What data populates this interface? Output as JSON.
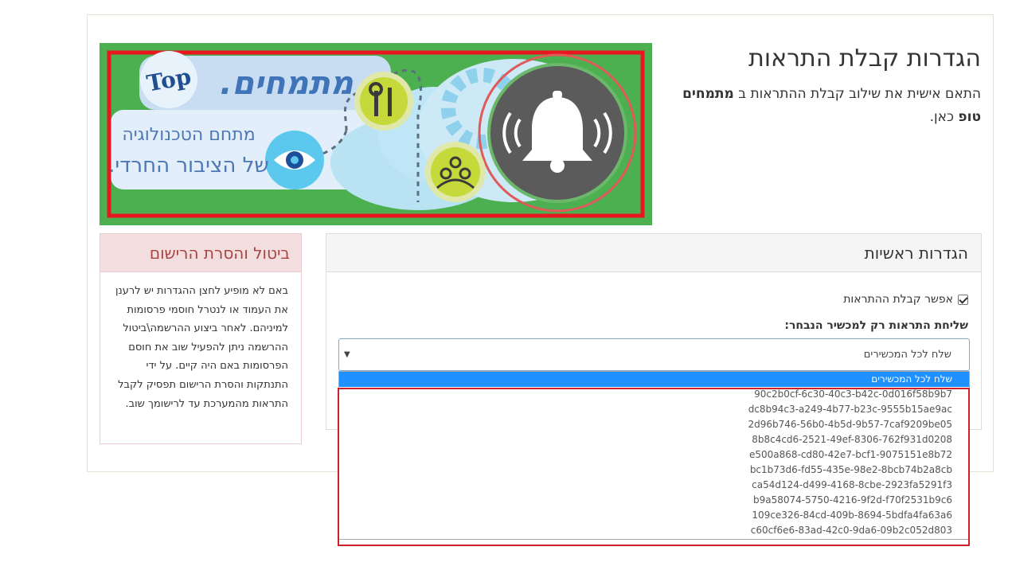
{
  "header": {
    "title": "הגדרות קבלת התראות",
    "intro_before": "התאם אישית את שילוב קבלת ההתראות ב ",
    "intro_brand": "מתמחים טופ",
    "intro_after": " כאן."
  },
  "banner": {
    "brand_text": "מתמחים.",
    "badge_text": "Top",
    "tagline_line1": "מתחם הטכנולוגיה",
    "tagline_line2": "של הציבור החרדי."
  },
  "main_panel": {
    "title": "הגדרות ראשיות",
    "enable_label": "אפשר קבלת ההתראות",
    "enable_checked": true,
    "device_field_label": "שליחת התראות רק למכשיר הנבחר:",
    "select_value": "שלח לכל המכשירים",
    "dropdown_options": [
      "שלח לכל המכשירים",
      "90c2b0cf-6c30-40c3-b42c-0d016f58b9b7",
      "dc8b94c3-a249-4b77-b23c-9555b15ae9ac",
      "2d96b746-56b0-4b5d-9b57-7caf9209be05",
      "8b8c4cd6-2521-49ef-8306-762f931d0208",
      "e500a868-cd80-42e7-bcf1-9075151e8b72",
      "bc1b73d6-fd55-435e-98e2-8bcb74b2a8cb",
      "ca54d124-d499-4168-8cbe-2923fa5291f3",
      "b9a58074-5750-4216-9f2d-f70f2531b9c6",
      "109ce326-84cd-409b-8694-5bdfa4fa63a6",
      "c60cf6e6-83ad-42c0-9da6-09b2c052d803"
    ]
  },
  "side_panel": {
    "title": "ביטול והסרת הרישום",
    "body": "באם לא מופיע לחצן ההגדרות יש לרענן את העמוד או לנטרל חוסמי פרסומות למיניהם. לאחר ביצוע ההרשמה\\ביטול ההרשמה ניתן להפעיל שוב את חוסם הפרסומות באם היה קיים. על ידי התנתקות והסרת הרישום תפסיק לקבל התראות מהמערכת עד לרישומך שוב."
  },
  "icons": {
    "bell": "bell-icon",
    "tools": "tools-icon",
    "eye": "eye-icon",
    "people": "people-icon",
    "gear": "gear-icon",
    "dropdown_arrow": "chevron-down-icon"
  },
  "colors": {
    "banner_green": "#4caf50",
    "annotation_red": "#e8161e",
    "side_panel_title": "#a94442",
    "side_panel_bg": "#f2dede",
    "selected_option": "#1e90ff"
  }
}
